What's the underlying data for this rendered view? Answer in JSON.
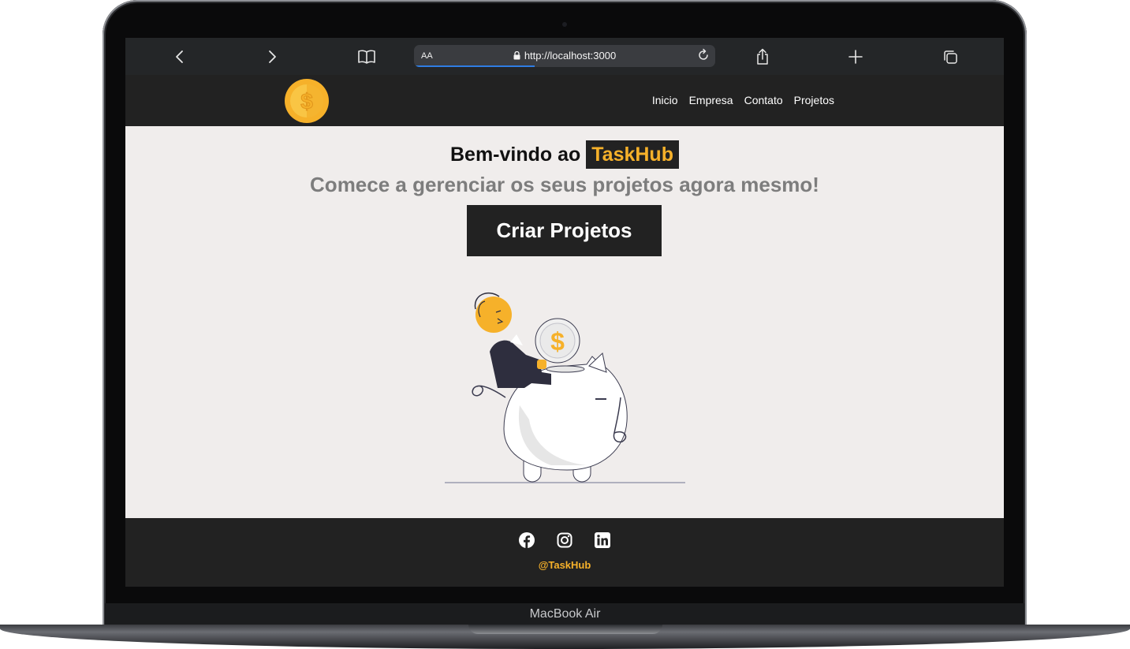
{
  "browser": {
    "text_size_label": "AA",
    "url": "http://localhost:3000",
    "load_progress": 0.4
  },
  "header": {
    "logo_icon": "coin-dollar-icon",
    "nav": [
      "Inicio",
      "Empresa",
      "Contato",
      "Projetos"
    ]
  },
  "hero": {
    "title_prefix": "Bem-vindo ao",
    "brand": "TaskHub",
    "subtitle": "Comece a gerenciar os seus projetos agora mesmo!",
    "cta_label": "Criar Projetos",
    "illustration": "person-inserting-coin-into-piggy-bank"
  },
  "footer": {
    "social_icons": [
      "facebook-icon",
      "instagram-icon",
      "linkedin-icon"
    ],
    "handle": "@TaskHub"
  },
  "device": {
    "brand_label": "MacBook Air"
  },
  "colors": {
    "accent": "#f6b12a",
    "dark": "#222222",
    "page_background": "#f0edec"
  }
}
